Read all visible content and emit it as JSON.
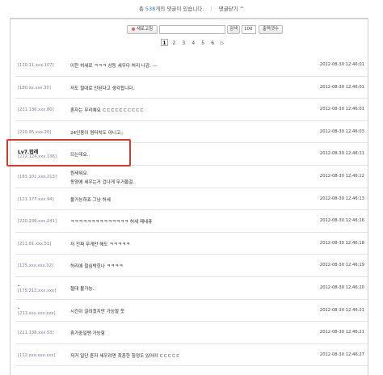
{
  "header": {
    "prefix": "총",
    "count": "538",
    "suffix": "개의 댓글이 있습니다.",
    "separator": "|",
    "fold_label": "댓글닫기 ^"
  },
  "controls": {
    "refresh_label": "새로고침",
    "search_value": "",
    "search_label": "검색",
    "count_value": "100",
    "perpage_label": "출력갯수"
  },
  "pagination": {
    "pages": [
      "1",
      "2",
      "3",
      "4",
      "5",
      "6"
    ],
    "current": "1",
    "next": "▷"
  },
  "comments": [
    {
      "name": "",
      "ip": "[110.11.xxx.107]",
      "text": "이찬 허세로 ㅋㅋㅋ 상등 세우다 허리 나감. ---",
      "text2": "",
      "date": "2012-08-30 12:46:01"
    },
    {
      "name": "",
      "ip": "[180.xx.xxx.30]",
      "text": "저도 절대로 안된다고 생각합니다.",
      "text2": "",
      "date": "2012-08-30 12:46:01"
    },
    {
      "name": "",
      "ip": "[211.136.xxx.80]",
      "text": "혼자는 무리예요 ㄷㄷㄷㄷㄷㄷㄷㄷㄷㄷ",
      "text2": "",
      "date": "2012-08-30 12:46:01"
    },
    {
      "name": "",
      "ip": "[220.95.xxx.20]",
      "text": "24인용이 원터치도 아니고;;",
      "text2": "",
      "date": "2012-08-30 12:46:03"
    },
    {
      "name": "Lv7.럽레",
      "ip": "[222.124.xxx.136]",
      "text": "되는데요..",
      "text2": "",
      "date": "2012-08-30 12:46:11"
    },
    {
      "name": "",
      "ip": "[183.101.xxx.213]",
      "text": "뭔세워요.",
      "text2": "동양에 세우는거 겁나게 무거울걸..",
      "date": "2012-08-30 12:46:12"
    },
    {
      "name": "",
      "ip": "[121.177.xxx.94]",
      "text": "불가능하죠 그냥 허세",
      "text2": "",
      "date": "2012-08-30 12:46:13"
    },
    {
      "name": "",
      "ip": "[220.236.xxx.241]",
      "text": "ㅋㅋㅋㅋㅋㅋㅋㅋㅋㅋㅋㅋㅋㅋ 허세 제네퓨",
      "text2": "",
      "date": "2012-08-30 12:46:16"
    },
    {
      "name": "",
      "ip": "[211.61.xxx.51]",
      "text": "저 진짜 무게만 해도 ㅋㅋㅋㅋㅋ",
      "text2": "",
      "date": "2012-08-30 12:46:18"
    },
    {
      "name": "",
      "ip": "[125.xxx.xxx.32]",
      "text": "허리에 철심박힌나 ㅋㅋㅋㅋ",
      "text2": "",
      "date": "2012-08-30 12:46:19"
    },
    {
      "name": ".",
      "ip": "[175.212.xxx.xxx]",
      "text": "절대 불가능..",
      "text2": "",
      "date": "2012-08-30 12:46:20"
    },
    {
      "name": ".",
      "ip": "[211.xxx.xxx.xxx]",
      "text": "시간이 걸려겠지만 가능할 듯",
      "text2": "",
      "date": "2012-08-30 12:46:21"
    },
    {
      "name": "",
      "ip": "[221.138.xxx.53]",
      "text": "휴가중일땐 가능함",
      "text2": "",
      "date": "2012-08-30 12:46:21"
    },
    {
      "name": "",
      "ip": "[112.xxx.xxx.xxx]",
      "text": "저거 일단 혼자 세우려면 최훈한 힘정도 있어야 ㄷㄷㄷㄷㄷ",
      "text2": "",
      "date": "2012-08-30 12:46:27"
    }
  ]
}
